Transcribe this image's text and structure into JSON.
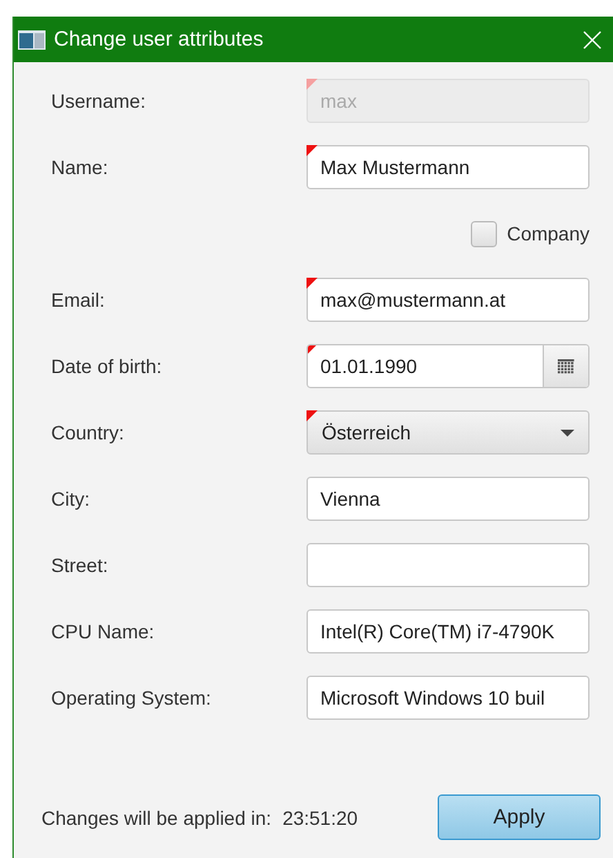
{
  "window": {
    "title": "Change user attributes"
  },
  "fields": [
    {
      "kind": "text",
      "label": "Username:",
      "value": "max",
      "required": true,
      "disabled": true
    },
    {
      "kind": "text",
      "label": "Name:",
      "value": "Max Mustermann",
      "required": true,
      "disabled": false
    },
    {
      "kind": "checkbox",
      "label": "Company",
      "checked": false
    },
    {
      "kind": "text",
      "label": "Email:",
      "value": "max@mustermann.at",
      "required": true,
      "disabled": false
    },
    {
      "kind": "date",
      "label": "Date of birth:",
      "value": "01.01.1990",
      "required": true
    },
    {
      "kind": "select",
      "label": "Country:",
      "value": "Österreich",
      "required": true
    },
    {
      "kind": "text",
      "label": "City:",
      "value": "Vienna",
      "required": false,
      "disabled": false
    },
    {
      "kind": "text",
      "label": "Street:",
      "required": false,
      "disabled": false
    },
    {
      "kind": "text",
      "label": "CPU Name:",
      "value": "Intel(R) Core(TM) i7-4790K",
      "required": false,
      "disabled": false
    },
    {
      "kind": "text",
      "label": "Operating System:",
      "value": "Microsoft Windows 10 buil",
      "required": false,
      "disabled": false
    }
  ],
  "footer": {
    "label": "Changes will be applied in:",
    "countdown": "23:51:20"
  },
  "buttons": [
    {
      "label": "Apply",
      "default": true
    }
  ]
}
